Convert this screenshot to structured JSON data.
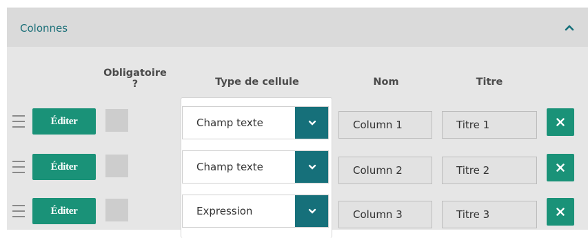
{
  "panel": {
    "title": "Colonnes"
  },
  "columns": {
    "required": "Obligatoire ?",
    "cell_type": "Type de cellule",
    "name": "Nom",
    "title": "Titre"
  },
  "edit_label": "Éditer",
  "rows": [
    {
      "cell_type": "Champ texte",
      "name": "Column 1",
      "title": "Titre 1"
    },
    {
      "cell_type": "Champ texte",
      "name": "Column 2",
      "title": "Titre 2"
    },
    {
      "cell_type": "Expression",
      "name": "Column 3",
      "title": "Titre 3"
    }
  ],
  "colors": {
    "accent": "#1a9278",
    "dropdown_button": "#16707a",
    "title": "#1b6f78"
  }
}
